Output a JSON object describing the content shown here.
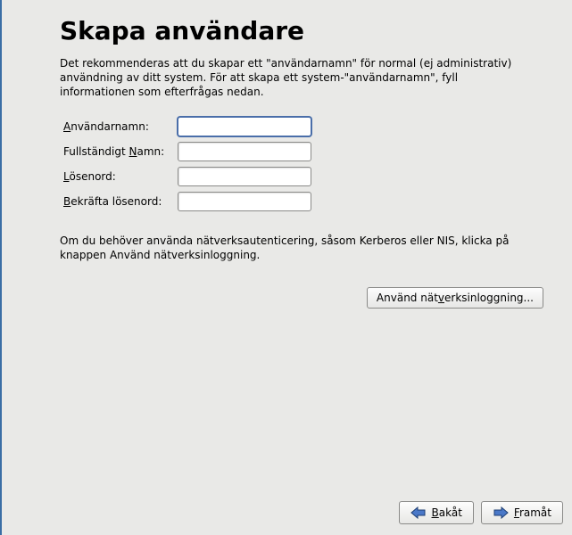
{
  "title": "Skapa användare",
  "description": "Det rekommenderas att du skapar ett \"användarnamn\" för normal (ej administrativ) användning av ditt system.  För att skapa ett system-\"användarnamn\", fyll informationen som efterfrågas nedan.",
  "form": {
    "username": {
      "label_pre": "A",
      "label_post": "nvändarnamn:",
      "value": "",
      "placeholder": ""
    },
    "fullname": {
      "label_pre_text": "Fullständigt ",
      "label_accel": "N",
      "label_post": "amn:",
      "value": "",
      "placeholder": ""
    },
    "password": {
      "label_pre": "L",
      "label_post": "ösenord:",
      "value": "",
      "placeholder": ""
    },
    "confirm": {
      "label_pre": "B",
      "label_post": "ekräfta lösenord:",
      "value": "",
      "placeholder": ""
    }
  },
  "network_hint": "Om du behöver använda nätverksautenticering, såsom Kerberos eller NIS, klicka på knappen Använd nätverksinloggning.",
  "network_button": {
    "pre": "Använd nät",
    "accel": "v",
    "post": "erksinloggning..."
  },
  "buttons": {
    "back": {
      "pre": "",
      "accel": "B",
      "post": "akåt"
    },
    "forward": {
      "pre": "",
      "accel": "F",
      "post": "ramåt"
    }
  },
  "colors": {
    "accent": "#3a6ea5",
    "button_border": "#8a8a88",
    "bg": "#e9e9e7"
  }
}
